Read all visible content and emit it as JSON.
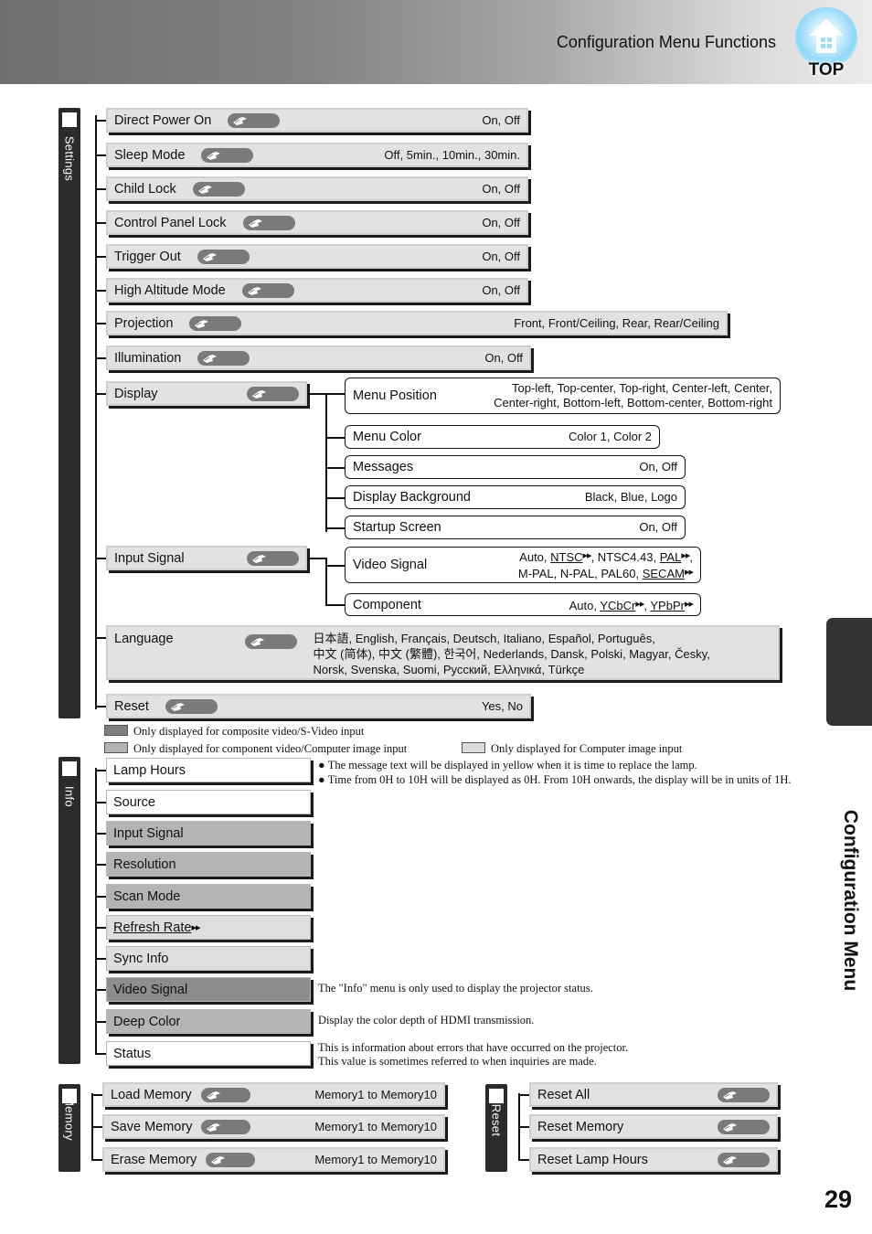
{
  "header": {
    "title": "Configuration Menu Functions",
    "top_label": "TOP"
  },
  "side": {
    "tab_label": "Configuration Menu"
  },
  "page": {
    "number": "29"
  },
  "settings": {
    "group_label": "Settings",
    "rows": [
      {
        "label": "Direct Power On",
        "values": "On, Off"
      },
      {
        "label": "Sleep Mode",
        "values": "Off, 5min., 10min., 30min."
      },
      {
        "label": "Child Lock",
        "values": "On, Off"
      },
      {
        "label": "Control Panel Lock",
        "values": "On, Off"
      },
      {
        "label": "Trigger Out",
        "values": "On, Off"
      },
      {
        "label": "High Altitude Mode",
        "values": "On, Off"
      },
      {
        "label": "Projection",
        "values": "Front, Front/Ceiling, Rear, Rear/Ceiling"
      },
      {
        "label": "Illumination",
        "values": "On, Off"
      }
    ],
    "display": {
      "label": "Display"
    },
    "input_signal": {
      "label": "Input Signal"
    },
    "language": {
      "label": "Language",
      "line1": "日本語, English, Français, Deutsch, Italiano, Español, Português,",
      "line2": "中文 (简体), 中文 (繁體), 한국어, Nederlands, Dansk, Polski, Magyar, Česky,",
      "line3": "Norsk, Svenska, Suomi, Русский, Ελληνικά, Türkçe"
    },
    "reset": {
      "label": "Reset",
      "values": "Yes, No"
    }
  },
  "display_submenu": [
    {
      "label": "Menu Position",
      "line1": "Top-left, Top-center, Top-right, Center-left, Center,",
      "line2": "Center-right, Bottom-left, Bottom-center, Bottom-right"
    },
    {
      "label": "Menu Color",
      "line1": "Color 1, Color 2",
      "line2": ""
    },
    {
      "label": "Messages",
      "line1": "On, Off",
      "line2": ""
    },
    {
      "label": "Display Background",
      "line1": "Black, Blue, Logo",
      "line2": ""
    },
    {
      "label": "Startup Screen",
      "line1": "On, Off",
      "line2": ""
    }
  ],
  "input_submenu": {
    "video_signal": {
      "label": "Video Signal",
      "l1a": "Auto, ",
      "l1b": "NTSC",
      "l1c": ", NTSC4.43, ",
      "l1d": "PAL",
      "l1e": ",",
      "l2a": "M-PAL, N-PAL, PAL60, ",
      "l2b": "SECAM"
    },
    "component": {
      "label": "Component",
      "a": "Auto, ",
      "b": "YCbCr",
      "c": ", ",
      "d": "YPbPr"
    }
  },
  "legend": {
    "composite": "Only displayed for composite video/S-Video input",
    "component": "Only displayed for component video/Computer image input",
    "computer": "Only displayed for Computer image input"
  },
  "info": {
    "group_label": "Info",
    "rows": [
      {
        "label": "Lamp Hours",
        "shade": "sh-white",
        "underline": false
      },
      {
        "label": "Source",
        "shade": "sh-white",
        "underline": false
      },
      {
        "label": "Input Signal",
        "shade": "sh-med",
        "underline": false
      },
      {
        "label": "Resolution",
        "shade": "sh-med",
        "underline": false
      },
      {
        "label": "Scan Mode",
        "shade": "sh-med",
        "underline": false
      },
      {
        "label": "Refresh Rate",
        "shade": "sh-light",
        "underline": true
      },
      {
        "label": "Sync Info",
        "shade": "sh-light",
        "underline": false
      },
      {
        "label": "Video Signal",
        "shade": "sh-dark",
        "underline": false
      },
      {
        "label": "Deep Color",
        "shade": "sh-med",
        "underline": false
      },
      {
        "label": "Status",
        "shade": "sh-white",
        "underline": false
      }
    ],
    "notes": {
      "bullet1": "The message text will be displayed in yellow when it is time to replace the lamp.",
      "bullet2": "Time from 0H to 10H will be displayed as 0H. From 10H onwards, the display will be in units of 1H.",
      "info_desc": "The \"Info\" menu is only used to display the projector status.",
      "deep_color_desc": "Display the color depth of HDMI transmission.",
      "status_desc1": "This is information about errors that have occurred on the projector.",
      "status_desc2": "This value is sometimes referred to when inquiries are made."
    }
  },
  "memory": {
    "group_label": "Memory",
    "rows": [
      {
        "label": "Load Memory",
        "values": "Memory1 to Memory10"
      },
      {
        "label": "Save Memory",
        "values": "Memory1 to Memory10"
      },
      {
        "label": "Erase Memory",
        "values": "Memory1 to Memory10"
      }
    ]
  },
  "reset_group": {
    "group_label": "Reset",
    "rows": [
      {
        "label": "Reset All",
        "values": ""
      },
      {
        "label": "Reset Memory",
        "values": ""
      },
      {
        "label": "Reset Lamp Hours",
        "values": ""
      }
    ]
  }
}
